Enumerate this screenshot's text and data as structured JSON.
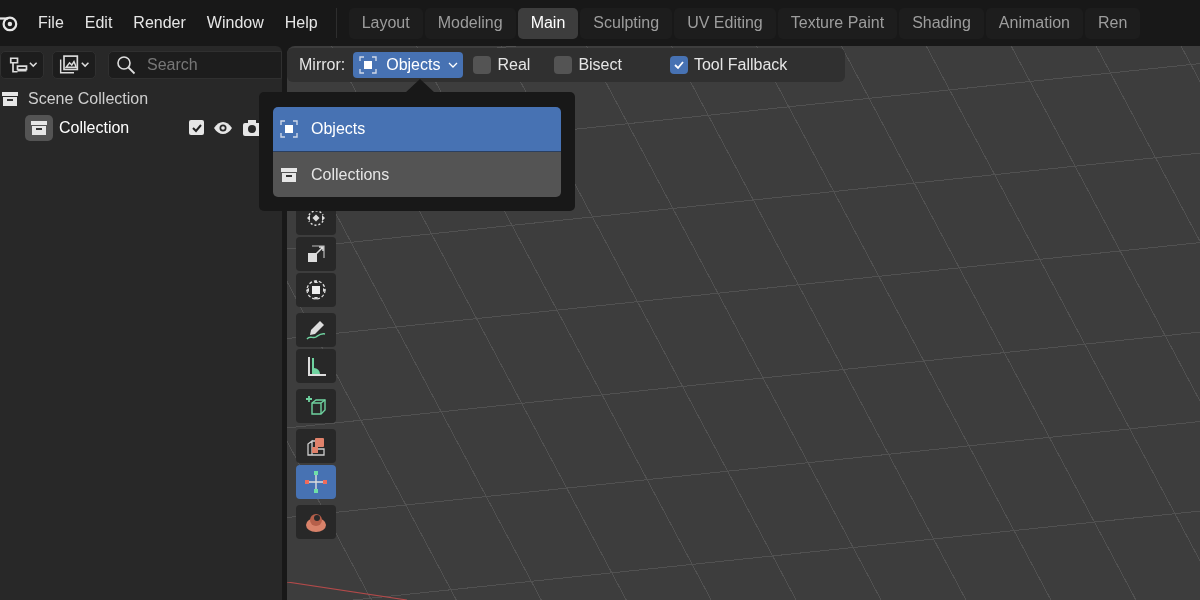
{
  "menu": [
    "File",
    "Edit",
    "Render",
    "Window",
    "Help"
  ],
  "workspaces": [
    {
      "label": "Layout",
      "selected": false
    },
    {
      "label": "Modeling",
      "selected": false
    },
    {
      "label": "Main",
      "selected": true
    },
    {
      "label": "Sculpting",
      "selected": false
    },
    {
      "label": "UV Editing",
      "selected": false
    },
    {
      "label": "Texture Paint",
      "selected": false
    },
    {
      "label": "Shading",
      "selected": false
    },
    {
      "label": "Animation",
      "selected": false
    },
    {
      "label": "Ren",
      "selected": false
    }
  ],
  "outliner": {
    "search": {
      "placeholder": "Search"
    },
    "tree": [
      {
        "label": "Scene Collection",
        "children": [
          {
            "label": "Collection",
            "checked": true
          }
        ]
      }
    ]
  },
  "tool_header": {
    "label": "Mirror:",
    "dropdown": {
      "value": "Objects"
    },
    "options": [
      {
        "label": "Real",
        "checked": false
      },
      {
        "label": "Bisect",
        "checked": false
      },
      {
        "label": "Tool Fallback",
        "checked": true
      }
    ]
  },
  "dropdown_menu": {
    "items": [
      {
        "label": "Objects",
        "kind": "objects",
        "selected": true
      },
      {
        "label": "Collections",
        "kind": "collections",
        "selected": false
      }
    ]
  },
  "toolbar": {
    "groups": [
      {
        "tools": [
          {
            "selected": false
          },
          {
            "selected": false
          },
          {
            "selected": false
          }
        ]
      },
      {
        "tools": [
          {
            "selected": false
          },
          {
            "selected": false
          }
        ]
      },
      {
        "tools": [
          {
            "selected": false
          }
        ]
      },
      {
        "tools": [
          {
            "selected": false
          },
          {
            "selected": true
          }
        ]
      },
      {
        "tools": [
          {
            "selected": false
          }
        ]
      }
    ]
  }
}
